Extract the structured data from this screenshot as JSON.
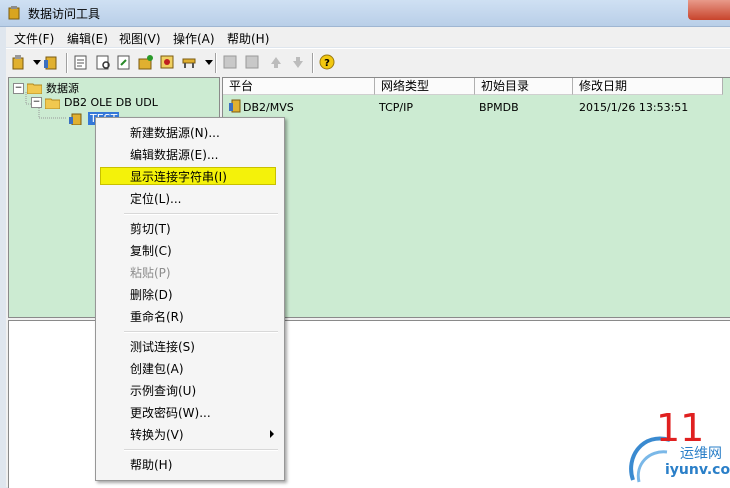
{
  "window": {
    "title": "数据访问工具"
  },
  "menu": [
    "文件(F)",
    "编辑(E)",
    "视图(V)",
    "操作(A)",
    "帮助(H)"
  ],
  "tree": {
    "root": "数据源",
    "child": "DB2 OLE DB UDL",
    "selected": "TEST"
  },
  "list": {
    "columns": [
      "平台",
      "网络类型",
      "初始目录",
      "修改日期"
    ],
    "row": [
      "DB2/MVS",
      "TCP/IP",
      "BPMDB",
      "2015/1/26 13:53:51"
    ]
  },
  "context_menu": {
    "items": [
      "新建数据源(N)...",
      "编辑数据源(E)...",
      "显示连接字符串(I)",
      "定位(L)...",
      "剪切(T)",
      "复制(C)",
      "粘贴(P)",
      "删除(D)",
      "重命名(R)",
      "测试连接(S)",
      "创建包(A)",
      "示例查询(U)",
      "更改密码(W)...",
      "转换为(V)",
      "帮助(H)"
    ],
    "highlighted_index": 2,
    "disabled_index": 6
  },
  "watermark": {
    "number": "11",
    "cn": "运维网",
    "url": "iyunv.com"
  },
  "colors": {
    "pane_bg": "#ccebd2",
    "highlight": "#f4f20a"
  }
}
